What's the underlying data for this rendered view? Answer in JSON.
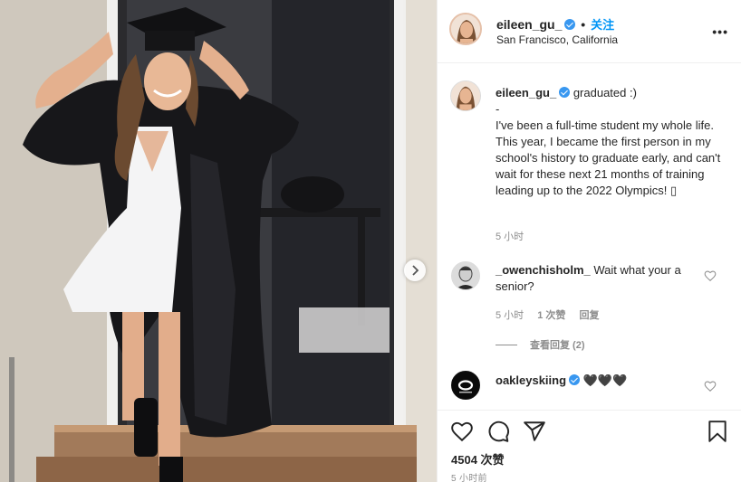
{
  "header": {
    "username": "eileen_gu_",
    "separator": "•",
    "follow_label": "关注",
    "location": "San Francisco, California",
    "more_label": "•••"
  },
  "caption": {
    "username": "eileen_gu_",
    "text_line1": "graduated :)",
    "text_line2": "-",
    "text_body": "I've been a full-time student my whole life. This year, I became the first person in my school's history to graduate early, and can't wait for these next 21 months of training leading up to the 2022 Olympics! ▯",
    "time": "5 小时"
  },
  "comments": [
    {
      "username": "_owenchisholm_",
      "text": "Wait what your a senior?",
      "time": "5 小时",
      "likes": "1 次赞",
      "reply_label": "回复",
      "view_replies": "查看回复 (2)"
    },
    {
      "username": "oakleyskiing",
      "text": "🖤🖤🖤"
    }
  ],
  "actions": {
    "like_count": "4504 次赞",
    "post_time": "5 小时前"
  },
  "colors": {
    "link": "#0095f6",
    "verified": "#3897f0",
    "muted": "#8e8e8e"
  }
}
